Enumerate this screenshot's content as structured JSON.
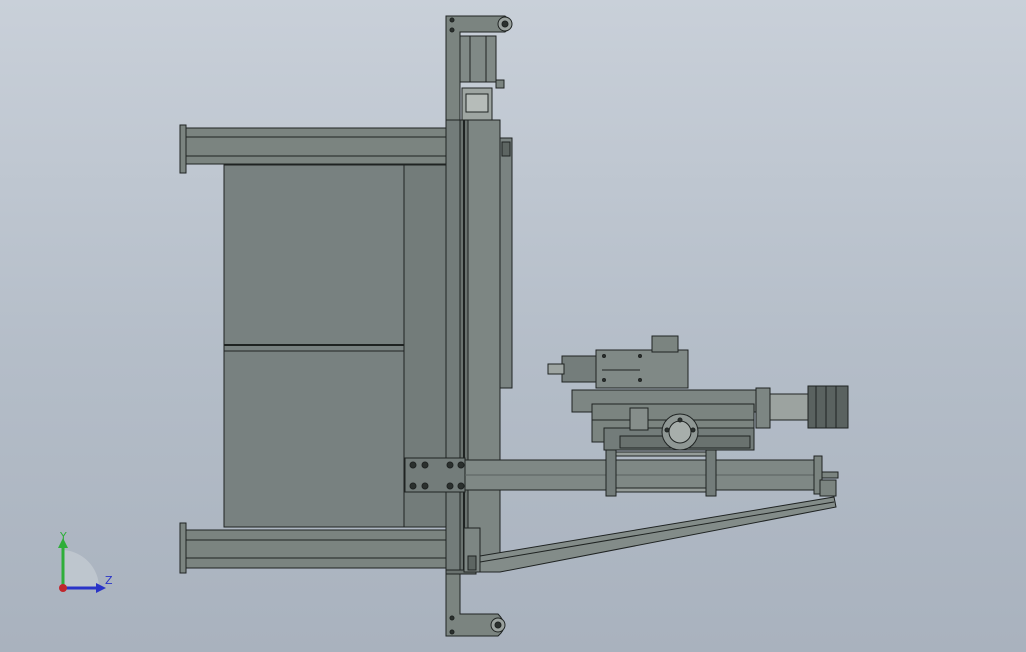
{
  "viewport": {
    "background_top": "#c9d0d9",
    "background_bottom": "#a9b2be"
  },
  "model": {
    "body_color": "#7b8480",
    "edge_color": "#1f2322",
    "shade_color": "#6a726f"
  },
  "triad": {
    "y_label": "Y",
    "z_label": "Z",
    "y_color": "#2fae3a",
    "z_color": "#2a34c8",
    "origin_color": "#c0262c"
  }
}
